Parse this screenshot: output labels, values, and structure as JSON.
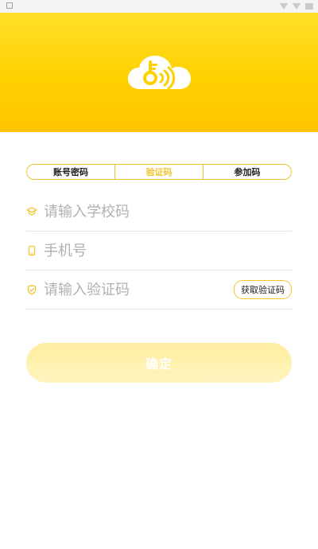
{
  "tabs": [
    "账号密码",
    "验证码",
    "参加码"
  ],
  "active_tab_index": 1,
  "fields": {
    "school_code": {
      "placeholder": "请输入学校码"
    },
    "phone": {
      "placeholder": "手机号"
    },
    "verification_code": {
      "placeholder": "请输入验证码"
    }
  },
  "get_code_label": "获取验证码",
  "confirm_label": "确定",
  "colors": {
    "brand_yellow": "#FFD000",
    "accent_border": "#F1C432",
    "placeholder": "#B0B0B0",
    "button_bg_light": "#FFF2B3"
  },
  "icons": {
    "logo": "cloud-key-wifi",
    "school": "graduation-cap",
    "phone": "phone",
    "verify": "shield-check"
  }
}
